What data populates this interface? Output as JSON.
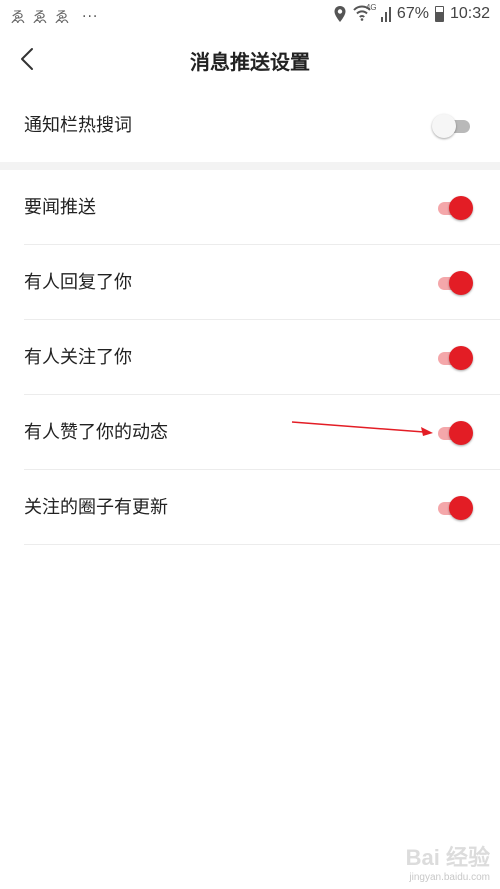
{
  "status_bar": {
    "app_icons": [
      "app-notification-icon",
      "app-notification-icon",
      "app-notification-icon"
    ],
    "more": "···",
    "network": "4G",
    "battery_level": "67%",
    "time": "10:32"
  },
  "header": {
    "back_icon": "chevron-left-icon",
    "title": "消息推送设置"
  },
  "settings": [
    {
      "label": "通知栏热搜词",
      "enabled": false
    },
    {
      "label": "要闻推送",
      "enabled": true
    },
    {
      "label": "有人回复了你",
      "enabled": true
    },
    {
      "label": "有人关注了你",
      "enabled": true
    },
    {
      "label": "有人赞了你的动态",
      "enabled": true
    },
    {
      "label": "关注的圈子有更新",
      "enabled": true
    }
  ],
  "colors": {
    "accent": "#e31d25",
    "accent_track": "#f4a7aa",
    "off_track": "#b9b9b9",
    "section_gap": "#f3f3f3"
  },
  "watermark": {
    "logo_text": "Bai 经验",
    "url": "jingyan.baidu.com"
  }
}
